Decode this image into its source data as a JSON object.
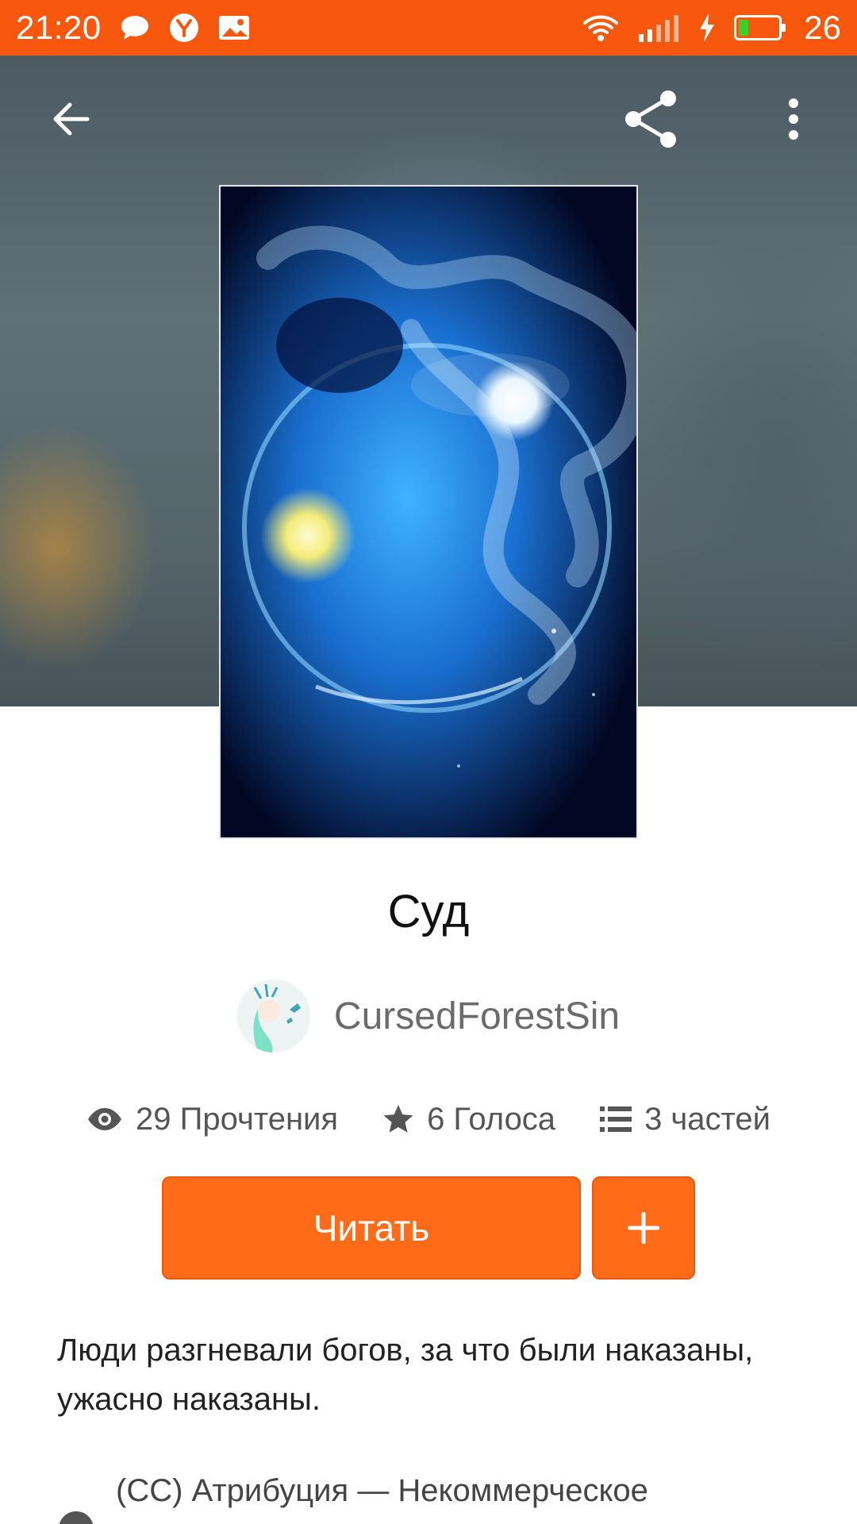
{
  "status_bar": {
    "time": "21:20",
    "battery_level": "26",
    "icons": [
      "chat-bubble-icon",
      "yandex-icon",
      "image-notification-icon",
      "wifi-icon",
      "signal-icon",
      "charging-icon",
      "battery-icon"
    ]
  },
  "toolbar": {
    "back_icon": "arrow-left-icon",
    "share_icon": "share-icon",
    "more_icon": "more-vertical-icon"
  },
  "story": {
    "title": "Суд",
    "author": "CursedForestSin",
    "stats": {
      "reads": "29 Прочтения",
      "votes": "6 Голоса",
      "parts": "3 частей"
    },
    "read_button": "Читать",
    "description": "Люди разгневали богов, за что были наказаны, ужасно наказаны.",
    "license": "(CC) Атрибуция — Некоммерческое"
  },
  "colors": {
    "accent": "#ff6b17",
    "status_bar": "#f8580e"
  }
}
